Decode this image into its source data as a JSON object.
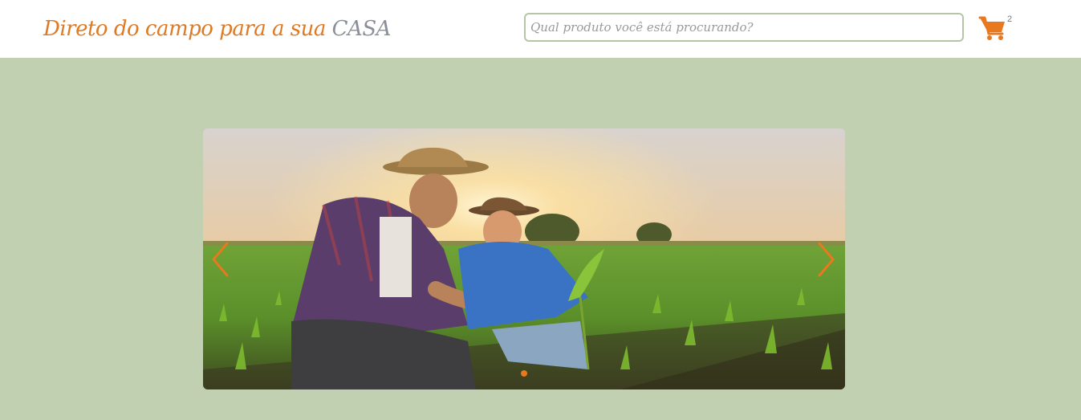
{
  "header": {
    "brand_main": "Direto do campo para a sua",
    "brand_accent": "CASA",
    "search_placeholder": "Qual produto você está procurando?",
    "search_value": "",
    "cart_icon": "cart-icon",
    "cart_count": "2"
  },
  "carousel": {
    "prev_icon": "chevron-left-icon",
    "next_icon": "chevron-right-icon",
    "slide_count": 1,
    "active_slide": 1
  },
  "colors": {
    "accent": "#e8791f",
    "background": "#c2d0b2",
    "header": "#ffffff",
    "search_border": "#b5c6a6"
  }
}
